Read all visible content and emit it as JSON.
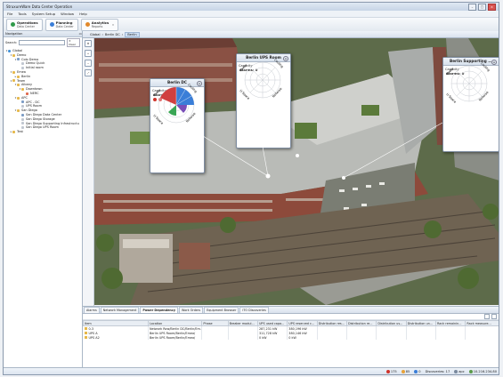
{
  "window": {
    "title": "StruxureWare Data Center Operation"
  },
  "menu": [
    "File",
    "Tools",
    "System Setup",
    "Window",
    "Help"
  ],
  "toolbar": {
    "operations": {
      "title": "Operations",
      "subtitle": "Data Center"
    },
    "planning": {
      "title": "Planning",
      "subtitle": "Data Center"
    },
    "analytics": {
      "title": "Analytics",
      "subtitle": "Reports"
    }
  },
  "navigation": {
    "title": "Navigation",
    "search_label": "Search:",
    "clear_label": "Clear",
    "tree": [
      {
        "label": "Global",
        "level": 0,
        "icon": "globe",
        "toggle": "-"
      },
      {
        "label": "Demo",
        "level": 1,
        "icon": "folder",
        "toggle": "-"
      },
      {
        "label": "Colo Demo",
        "level": 2,
        "icon": "dc",
        "toggle": "-"
      },
      {
        "label": "Demo Quick",
        "level": 3,
        "icon": "room",
        "toggle": ""
      },
      {
        "label": "Initial room",
        "level": 3,
        "icon": "room",
        "toggle": ""
      },
      {
        "label": "Emea",
        "level": 1,
        "icon": "folder",
        "toggle": "-"
      },
      {
        "label": "Berlin",
        "level": 2,
        "icon": "folder",
        "toggle": "+"
      },
      {
        "label": "Team",
        "level": 1,
        "icon": "folder",
        "toggle": "-"
      },
      {
        "label": "Albany",
        "level": 2,
        "icon": "folder",
        "toggle": "-"
      },
      {
        "label": "Downtown",
        "level": 3,
        "icon": "folder",
        "toggle": "-"
      },
      {
        "label": "NERC",
        "level": 4,
        "icon": "warn",
        "toggle": ""
      },
      {
        "label": "APC",
        "level": 2,
        "icon": "folder",
        "toggle": "-"
      },
      {
        "label": "APC - DC",
        "level": 3,
        "icon": "dc",
        "toggle": ""
      },
      {
        "label": "UPS Room",
        "level": 3,
        "icon": "room",
        "toggle": ""
      },
      {
        "label": "San Diego",
        "level": 2,
        "icon": "folder",
        "toggle": "-"
      },
      {
        "label": "San Diego Data Center",
        "level": 3,
        "icon": "dc",
        "toggle": ""
      },
      {
        "label": "San Diego Storage",
        "level": 3,
        "icon": "room",
        "toggle": ""
      },
      {
        "label": "San Diego Supporting Infrastructu",
        "level": 3,
        "icon": "room",
        "toggle": ""
      },
      {
        "label": "San Diego UPS Room",
        "level": 3,
        "icon": "room",
        "toggle": ""
      },
      {
        "label": "Test",
        "level": 1,
        "icon": "folder",
        "toggle": "+"
      }
    ]
  },
  "editor_tabs": {
    "global": "Global",
    "berlin_dc": "Berlin DC",
    "berlin": "Berlin"
  },
  "cards": {
    "berlin_dc": {
      "title": "Berlin DC",
      "capacity": "Capacity",
      "alarms": "Alarms: 6",
      "axes": [
        "Power",
        "Cooling",
        "U-Space",
        "Network"
      ]
    },
    "ups_room": {
      "title": "Berlin UPS Room",
      "capacity": "Capacity",
      "alarms": "Alarms: 0",
      "axes": [
        "Power",
        "Cooling",
        "U-Space",
        "Network"
      ]
    },
    "supporting": {
      "title": "Berlin Supporting ...",
      "capacity": "Capacity",
      "alarms": "Alarms: 0",
      "axes": [
        "Power",
        "Cooling",
        "U-Space",
        "Network"
      ]
    }
  },
  "bottom_tabs": [
    "Alarms",
    "Network Management",
    "Power Dependency",
    "Work Orders",
    "Equipment Browser",
    "ITO Discoveries"
  ],
  "table": {
    "columns": [
      "Item",
      "Location",
      "Phase",
      "Breaker modul...",
      "UPS used capa...",
      "UPS reserved c...",
      "Distribution res...",
      "Distribution re...",
      "Distribution us...",
      "Distribution un...",
      "Rack remainin...",
      "Rack measure..."
    ],
    "rows": [
      [
        "0-3",
        "Network Row/Berlin DC/Berlin/Em...",
        "",
        "",
        "287,231 kW",
        "380,196 kW",
        "",
        "",
        "",
        "",
        "",
        ""
      ],
      [
        "UPS A",
        "Berlin UPS Room/Berlin/Emea/",
        "",
        "",
        "311,728 kW",
        "380,146 kW",
        "",
        "",
        "",
        "",
        "",
        ""
      ],
      [
        "UPS A2",
        "Berlin UPS Room/Berlin/Emea/",
        "",
        "",
        "0 kW",
        "0 kW",
        "",
        "",
        "",
        "",
        "",
        ""
      ]
    ]
  },
  "status": {
    "critical": "175",
    "warning": "85",
    "info": "0",
    "discoveries": "Discoveries: 17",
    "user": "apc",
    "server": "10.216.234.80"
  },
  "colors": {
    "power": "#d04040",
    "cooling": "#3a7ed8",
    "uspace": "#3aa655",
    "network": "#7a4fb8",
    "alarm": "#d0342c"
  }
}
